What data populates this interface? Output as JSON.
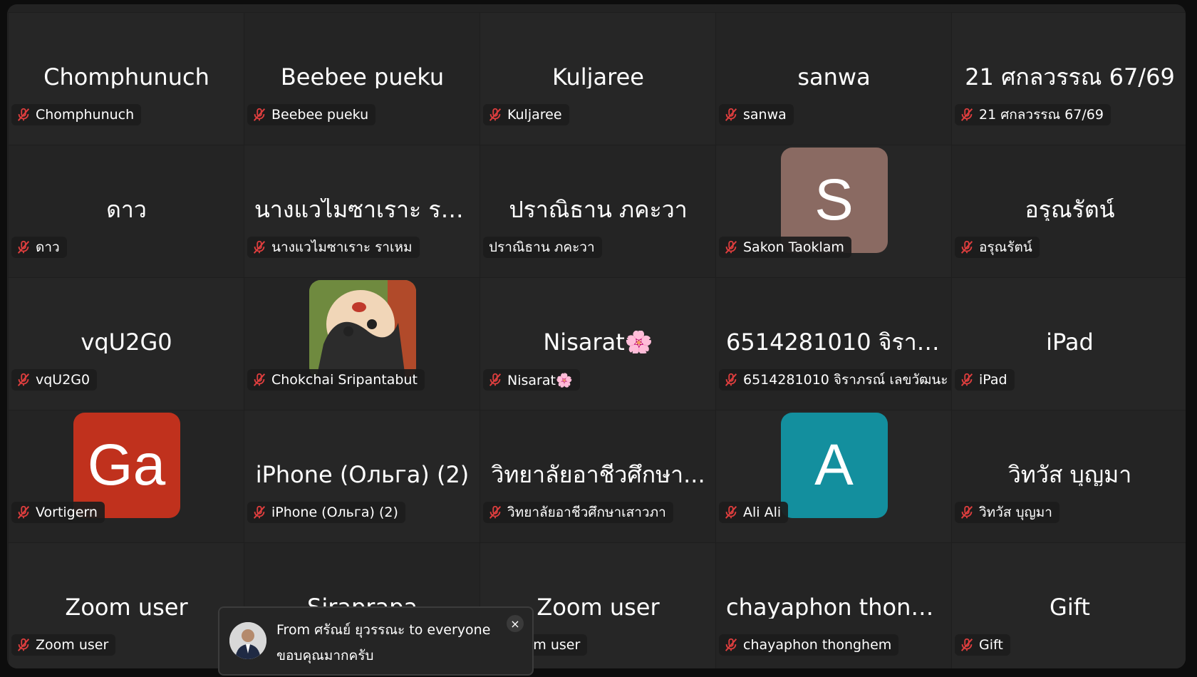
{
  "colors": {
    "stage_bg": "#232323",
    "mic_muted": "#e03e3e",
    "avatar_s": "#8a6a62",
    "avatar_ga": "#c0311d",
    "avatar_a": "#138f9e"
  },
  "tiles": [
    {
      "display": "Chomphunuch",
      "label": "Chomphunuch"
    },
    {
      "display": "Beebee pueku",
      "label": "Beebee pueku"
    },
    {
      "display": "Kuljaree",
      "label": "Kuljaree"
    },
    {
      "display": "sanwa",
      "label": "sanwa"
    },
    {
      "display": "21 ศกลวรรณ 67/69",
      "label": "21 ศกลวรรณ 67/69"
    },
    {
      "display": "ดาว",
      "label": "ดาว"
    },
    {
      "display": "นางแวไมซาเราะ รา...",
      "label": "นางแวไมซาเราะ ราเหม"
    },
    {
      "display": "ปราณิธาน ภคะวา",
      "label": "ปราณิธาน ภคะวา"
    },
    {
      "avatar_letter": "S",
      "label": "Sakon Taoklam"
    },
    {
      "display": "อรุณรัตน์",
      "label": "อรุณรัตน์"
    },
    {
      "display": "vqU2G0",
      "label": "vqU2G0"
    },
    {
      "label": "Chokchai Sripantabut"
    },
    {
      "display": "Nisarat🌸",
      "label": "Nisarat🌸"
    },
    {
      "display": "6514281010 จิราภ...",
      "label": "6514281010 จิราภรณ์ เลขวัฒนะ"
    },
    {
      "display": "iPad",
      "label": "iPad"
    },
    {
      "avatar_letter": "Ga",
      "label": "Vortigern"
    },
    {
      "display": "iPhone (Ольга) (2)",
      "label": "iPhone (Ольга) (2)"
    },
    {
      "display": "วิทยาลัยอาชีวศึกษา...",
      "label": "วิทยาลัยอาชีวศึกษาเสาวภา"
    },
    {
      "avatar_letter": "A",
      "label": "Ali Ali"
    },
    {
      "display": "วิทวัส บุญมา",
      "label": "วิทวัส บุญมา"
    },
    {
      "display": "Zoom user",
      "label": "Zoom user"
    },
    {
      "display": "Siraprapa",
      "label": ""
    },
    {
      "display": "Zoom user",
      "label": "Zoom user"
    },
    {
      "display": "chayaphon thongh...",
      "label": "chayaphon thonghem"
    },
    {
      "display": "Gift",
      "label": "Gift"
    }
  ],
  "chat_toast": {
    "from_text": "From ศรัณย์ ยุวรรณะ to everyone",
    "message": "ขอบคุณมากครับ",
    "close_icon": "×"
  }
}
